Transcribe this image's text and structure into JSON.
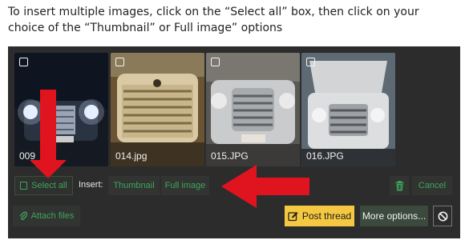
{
  "instruction": "To insert multiple images, click on the “Select all” box, then click on your choice of the “Thumbnail” or Full image” options",
  "thumbnails": [
    {
      "caption": "009",
      "selected": false
    },
    {
      "caption": "014.jpg",
      "selected": false
    },
    {
      "caption": "015.JPG",
      "selected": false
    },
    {
      "caption": "016.JPG",
      "selected": false
    }
  ],
  "toolbar": {
    "select_all": "Select all",
    "insert_label": "Insert:",
    "thumbnail": "Thumbnail",
    "full_image": "Full image",
    "cancel": "Cancel"
  },
  "footer": {
    "attach_files": "Attach files",
    "post_thread": "Post thread",
    "more_options": "More options..."
  },
  "colors": {
    "panel_bg": "#2c2c2c",
    "accent_green": "#3fa45b",
    "post_yellow": "#f5c842",
    "arrow_red": "#e0141e"
  }
}
